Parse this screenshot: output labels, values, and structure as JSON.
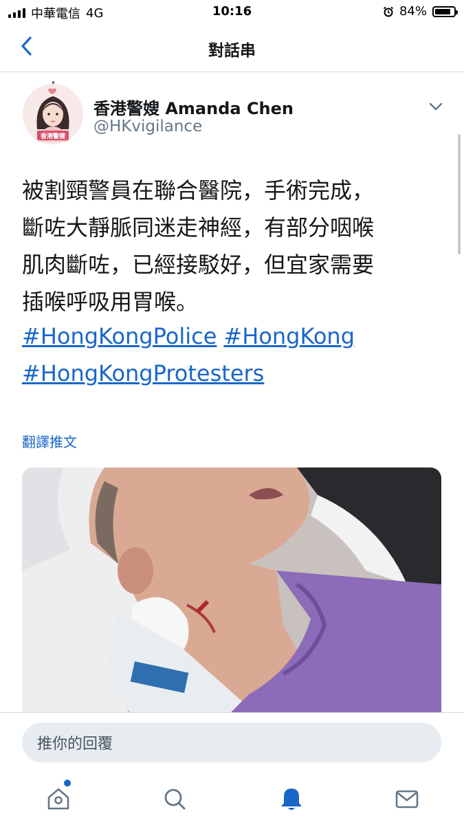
{
  "status_bar": {
    "carrier": "中華電信",
    "network": "4G",
    "time": "10:16",
    "battery_percent": "84%",
    "battery_level": 0.84
  },
  "header": {
    "title": "對話串",
    "back_icon": "chevron-left-icon"
  },
  "tweet": {
    "author_name": "香港警嫂 Amanda Chen",
    "handle": "@HKvigilance",
    "avatar_badge": "香港警嫂",
    "text_lines": [
      "被割頸警員在聯合醫院，手術完成，",
      "斷咗大靜脈同迷走神經，有部分咽喉",
      "肌肉斷咗，已經接駁好，但宜家需要",
      "插喉呼吸用胃喉。"
    ],
    "hashtags": [
      "#HongKongPolice",
      "#HongKong",
      "#HongKongProtesters"
    ],
    "translate_label": "翻譯推文"
  },
  "reply": {
    "placeholder": "推你的回覆"
  },
  "tabs": [
    {
      "icon": "home-icon",
      "has_notification_dot": true
    },
    {
      "icon": "search-icon"
    },
    {
      "icon": "bell-icon",
      "active": true
    },
    {
      "icon": "mail-icon"
    }
  ],
  "colors": {
    "accent": "#1a66c8",
    "text": "#14171a",
    "secondary_text": "#657786",
    "divider": "#d6dbdf",
    "input_bg": "#e6ecf0"
  }
}
